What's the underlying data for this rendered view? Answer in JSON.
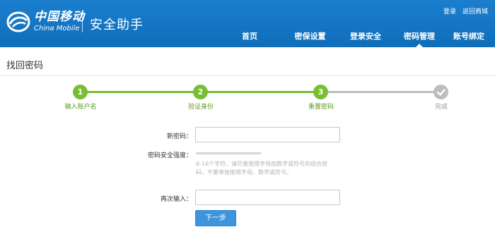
{
  "header": {
    "logo_cn": "中国移动",
    "logo_en": "China Mobile",
    "app_title": "安全助手",
    "top_links": [
      "登录",
      "返回商城"
    ],
    "nav": [
      {
        "label": "首页",
        "active": false
      },
      {
        "label": "密保设置",
        "active": false
      },
      {
        "label": "登录安全",
        "active": false
      },
      {
        "label": "密码管理",
        "active": true
      },
      {
        "label": "账号绑定",
        "active": false
      }
    ],
    "brand_color": "#1474c4"
  },
  "page_title": "找回密码",
  "steps": [
    {
      "number": "1",
      "label": "输入账户名",
      "state": "done"
    },
    {
      "number": "2",
      "label": "验证身份",
      "state": "done"
    },
    {
      "number": "3",
      "label": "重置密码",
      "state": "current"
    },
    {
      "number": "",
      "label": "完成",
      "state": "pending",
      "icon": "check-icon"
    }
  ],
  "step_colors": {
    "done": "#78be32",
    "pending": "#bdbdbd"
  },
  "form": {
    "new_password_label": "新密码：",
    "new_password_value": "",
    "strength_label": "密码安全强度：",
    "strength_level": 0,
    "hint": "6-16个字符，请尽量使用字母加数字或符号的组合密码，不要单独使用字母、数字或符号。",
    "confirm_label": "再次输入：",
    "confirm_value": "",
    "next_button": "下一步"
  }
}
